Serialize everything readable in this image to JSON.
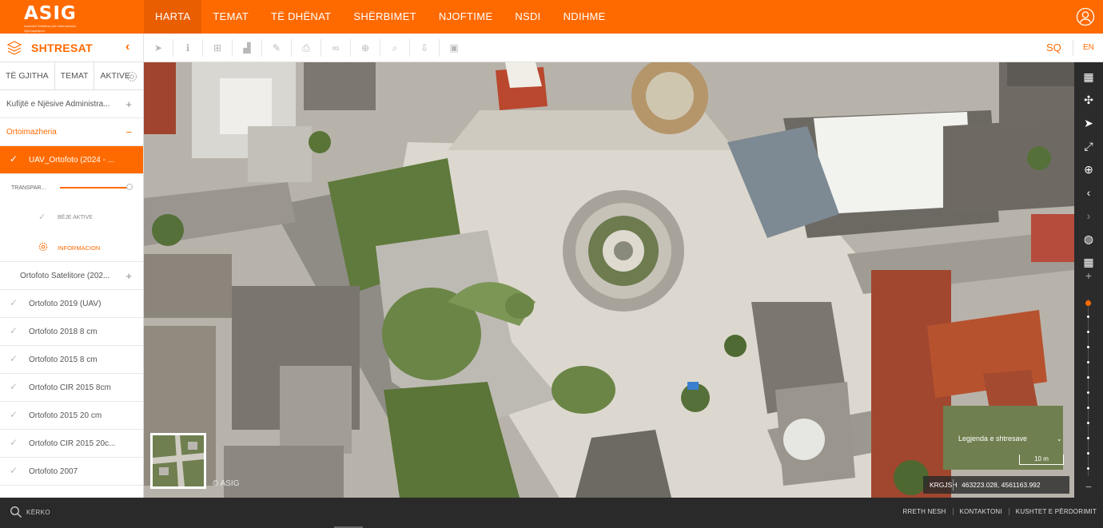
{
  "header": {
    "logo_text": "ASIG",
    "logo_subtitle": "Autoriteti Shtetëror për Informacionin Gjeohapësinor",
    "nav": [
      {
        "label": "HARTA",
        "active": true
      },
      {
        "label": "TEMAT"
      },
      {
        "label": "TË DHËNAT"
      },
      {
        "label": "SHËRBIMET"
      },
      {
        "label": "NJOFTIME"
      },
      {
        "label": "NSDI"
      },
      {
        "label": "NDIHME"
      }
    ],
    "user_icon": "user-circle-icon",
    "accent_color": "#ff6a00"
  },
  "toolbar": {
    "panel_title": "SHTRESAT",
    "panel_icon": "layers-icon",
    "collapse_icon": "chevron-left-icon",
    "tools": [
      "pointer-icon",
      "info-icon",
      "add-box-icon",
      "chart-icon",
      "edit-icon",
      "print-icon",
      "link-icon",
      "plus-circle-icon",
      "search-icon",
      "download-icon",
      "image-icon"
    ],
    "lang_sq": "SQ",
    "lang_en": "EN"
  },
  "sidebar": {
    "tabs": [
      "TË GJITHA",
      "TEMAT",
      "AKTIVE"
    ],
    "settings_icon": "gear-icon",
    "layers": {
      "kufijte": "Kufijtë e Njësive Administra...",
      "ortoimazheria": "Ortoimazheria",
      "active_layer": "UAV_Ortofoto (2024 - ...",
      "transparency_label": "TRANSPAR...",
      "transparency_value": 1.0,
      "make_active": "BËJE AKTIVE",
      "information": "INFORMACION",
      "satelitore": "Ortofoto Satelitore (202...",
      "items": [
        "Ortofoto 2019 (UAV)",
        "Ortofoto 2018 8 cm",
        "Ortofoto 2015 8 cm",
        "Ortofoto CIR 2015 8cm",
        "Ortofoto 2015 20 cm",
        "Ortofoto CIR 2015 20c...",
        "Ortofoto 2007"
      ]
    }
  },
  "map": {
    "watermark": "© ASIG",
    "legend_select": "Legjenda e shtresave",
    "scale_label": "10 m",
    "crs": "KRGJSH",
    "coordinates": "463223.028, 4561163.992"
  },
  "rightbar": {
    "buttons": [
      "basemap-icon",
      "fullscreen-arrows-icon",
      "locate-arrow-icon",
      "expand-icon",
      "zoom-box-icon",
      "chevron-left-icon",
      "chevron-right-icon",
      "globe-icon",
      "grid-icon",
      "zoom-in-icon"
    ],
    "zoom_out_icon": "zoom-out-icon",
    "zoom_level_fraction": 0.0
  },
  "footer": {
    "search_label": "KËRKO",
    "links": [
      "RRETH NESH",
      "KONTAKTONI",
      "KUSHTET E PËRDORIMIT"
    ]
  }
}
